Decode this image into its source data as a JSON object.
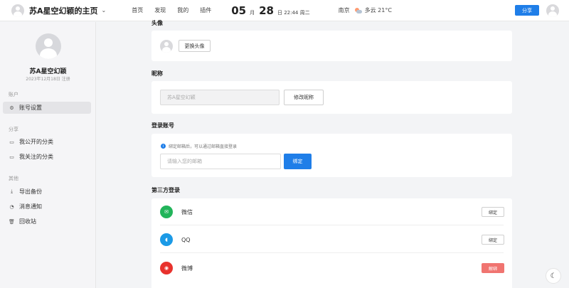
{
  "header": {
    "title": "苏A星空幻颖的主页",
    "nav": [
      "首页",
      "发现",
      "我的",
      "插件"
    ],
    "date": {
      "month": "05",
      "month_unit": "月",
      "day": "28",
      "rest": "日 22:44 周二"
    },
    "weather": {
      "city": "南京",
      "text": "多云 21°C"
    },
    "share_label": "分享"
  },
  "sidebar": {
    "name": "苏A星空幻颖",
    "register_date": "2023年12月18日 注册",
    "sections": [
      {
        "title": "账户",
        "items": [
          {
            "label": "账号设置",
            "icon": "gear-icon"
          }
        ]
      },
      {
        "title": "分享",
        "items": [
          {
            "label": "我公开的分类",
            "icon": "folder-icon"
          },
          {
            "label": "我关注的分类",
            "icon": "folder-icon"
          }
        ]
      },
      {
        "title": "其他",
        "items": [
          {
            "label": "导出备份",
            "icon": "download-icon"
          },
          {
            "label": "消息通知",
            "icon": "bell-icon"
          },
          {
            "label": "回收站",
            "icon": "trash-icon"
          }
        ]
      }
    ]
  },
  "main": {
    "avatar_section": {
      "title": "头像",
      "button": "更换头像"
    },
    "nickname_section": {
      "title": "昵称",
      "value": "苏A星空幻颖",
      "button": "修改昵称"
    },
    "login_section": {
      "title": "登录账号",
      "hint": "绑定邮箱后，可以通过邮箱直接登录",
      "placeholder": "请输入您的邮箱",
      "button": "绑定"
    },
    "third_party": {
      "title": "第三方登录",
      "items": [
        {
          "name": "微信",
          "action": "绑定",
          "color": "#22b45a",
          "icon": "wechat-icon"
        },
        {
          "name": "QQ",
          "action": "绑定",
          "color": "#1b9ae6",
          "icon": "qq-icon"
        },
        {
          "name": "微博",
          "action": "解绑",
          "color": "#e8322d",
          "icon": "weibo-icon"
        }
      ]
    }
  },
  "colors": {
    "accent": "#1f7ee8",
    "danger": "#f07470"
  }
}
